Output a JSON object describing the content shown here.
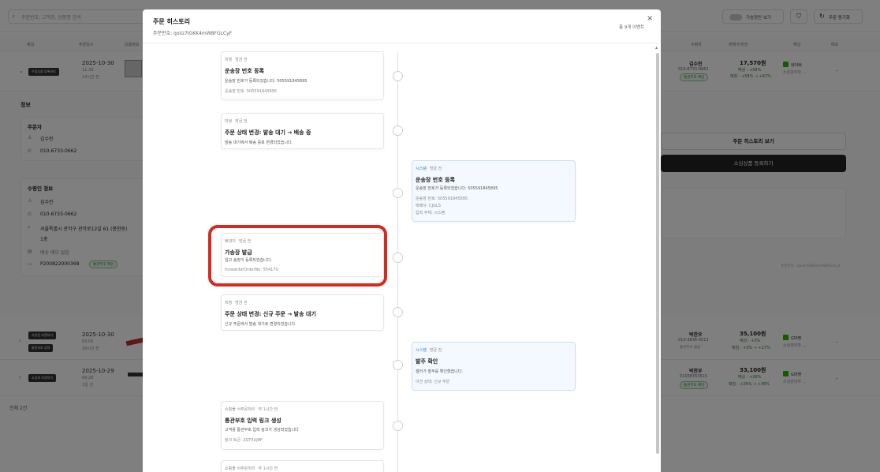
{
  "topbar": {
    "search_placeholder": "주문번호, 고객명, 상품명 검색",
    "virtual_toggle_label": "가송장만 보기",
    "sync_label": "주문 동기화"
  },
  "table_headers": [
    "채널",
    "주문일시",
    "상품정보",
    "수령자",
    "판매가/마진",
    "채널",
    "메모"
  ],
  "rows": [
    {
      "tag": "수집상품 등록하기",
      "date": "2025-10-30",
      "time": "11:39",
      "ago": "14시간 전",
      "buyer": "김수린",
      "phone": "010-6733-0662",
      "customs": "통관부호 확인",
      "price": "17,570원",
      "margin": "예상 : +58%",
      "channel_rate": "매칭 : +58% → +67%",
      "channel": "네이버",
      "channel_sub": "소싱관리자 ...",
      "memo": "-"
    },
    {
      "tag": "가송장 지정하기",
      "tag2": "통관부호 입력",
      "date": "2025-10-30",
      "time": "09:00",
      "ago": "16시간 전",
      "buyer": "박찬우",
      "phone": "010-3836-0513",
      "customs": "통관부호 없음",
      "price": "35,100원",
      "margin": "예상 : +3%",
      "channel_rate": "매칭 : +3% → +17%",
      "channel": "G마켓",
      "channel_sub": "소싱관리자 ...",
      "memo": "-"
    },
    {
      "tag": "소싱처 지정하기",
      "date": "2025-10-29",
      "time": "09:28",
      "ago": "1일 전",
      "buyer": "박찬우",
      "phone": "01038353515",
      "customs": "통관부호 확인",
      "price": "33,100원",
      "margin": "예상 : +26%",
      "channel_rate": "매칭 : +26% → +36%",
      "channel": "G마켓",
      "channel_sub": "소싱관리자 ...",
      "memo": "-"
    }
  ],
  "detail": {
    "section_title": "정보",
    "orderer_title": "주문자",
    "orderer_name": "김수린",
    "orderer_phone": "010-6733-0662",
    "recipient_title": "수령인 정보",
    "recipient_name": "김수린",
    "recipient_phone": "010-6733-0662",
    "address": "서울특별시 관악구 관악로12길 61 (봉천동)",
    "address_detail": "1층",
    "memo": "배송 메모 없음",
    "customs_code": "P200822000368",
    "customs_badge": "통관부호 확인",
    "history_button": "주문 히스토리 보기",
    "register_button": "소싱상품 등록하기",
    "footnote": "주문번호 : qoiiz7IGKK4mW8FGLCyF",
    "total": "전체 2건"
  },
  "modal": {
    "title": "주문 히스토리",
    "order_no": "주문번호: qoiiz7IGKK4mW8FGLCyF",
    "count": "총 9개 이벤트",
    "close_glyph": "×",
    "events": [
      {
        "side": "left",
        "who": "미정",
        "time": "방금 전",
        "title": "운송장 번호 등록",
        "l1": "운송장 번호가 등록되었습니다: 505591845895",
        "l2": "운송장 번호: 505591845895"
      },
      {
        "side": "left",
        "who": "미정",
        "time": "방금 전",
        "title": "주문 상태 변경: 발송 대기 → 배송 중",
        "l1": "발송 대기에서 배송 중로 변경되었습니다."
      },
      {
        "side": "right",
        "who": "시스템",
        "time": "방금 전",
        "title": "운송장 번호 등록",
        "l1": "운송장 번호가 등록되었습니다: 505591845895",
        "l2": "운송장 번호: 505591845895",
        "l3": "택배사: CJGLS",
        "l4": "입력 주체: 시스템"
      },
      {
        "side": "left",
        "who": "배대지",
        "time": "방금 전",
        "title": "가송장 발급",
        "l1": "입고 송장이 등록되었습니다.",
        "l2": "forwarderOrderNo: 554170",
        "highlight": true
      },
      {
        "side": "left",
        "who": "미정",
        "time": "방금 전",
        "title": "주문 상태 변경: 신규 주문 → 발송 대기",
        "l1": "신규 주문에서 발송 대기로 변경되었습니다."
      },
      {
        "side": "right",
        "who": "시스템",
        "time": "방금 전",
        "title": "발주 확인",
        "l1": "셀러가 발주를 확인했습니다.",
        "l2": "이전 상태: 신규 주문"
      },
      {
        "side": "left",
        "who": "쇼핑몰 서주문처리",
        "time": "약 1시간 전",
        "title": "통관부호 입력 링크 생성",
        "l1": "고객용 통관부호 입력 링크가 생성되었습니다",
        "l2": "링크 토큰: 2QT4UJ8F"
      },
      {
        "side": "left",
        "who": "쇼핑몰 서주문처리",
        "time": "약 1시간 전",
        "title": "",
        "l1": ""
      }
    ]
  },
  "colors": {
    "highlight_border": "#d9281e",
    "overlay": "rgba(0,0,0,0.5)",
    "green_badge": "#2e7d32",
    "system_blue": "#3a7bd5"
  }
}
